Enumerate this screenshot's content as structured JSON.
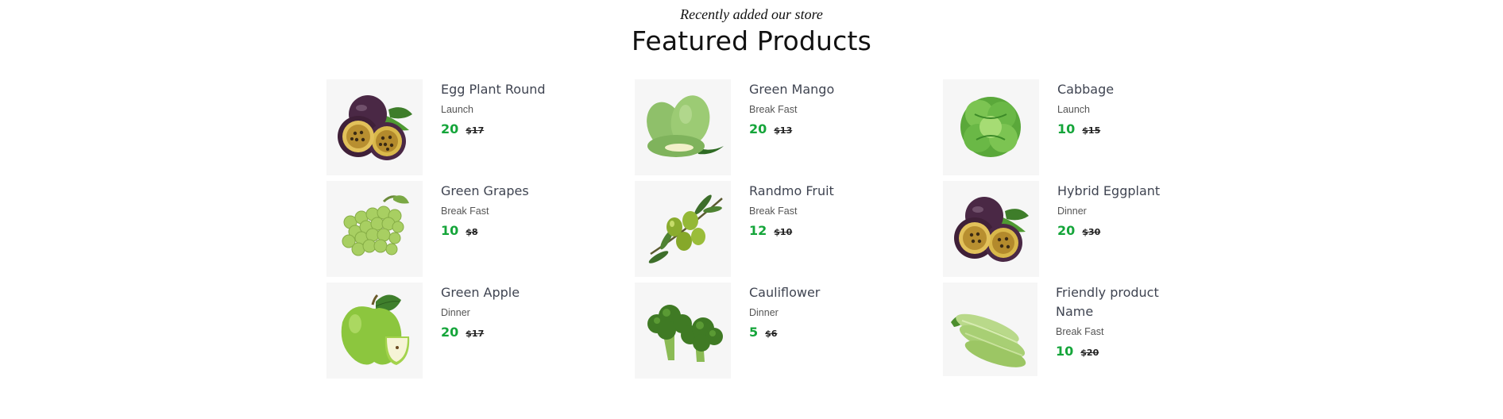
{
  "header": {
    "subtitle": "Recently added our store",
    "title": "Featured Products"
  },
  "colors": {
    "price": "#15a53a",
    "name": "#3f4451",
    "thumb_bg": "#f6f6f6"
  },
  "products": [
    {
      "name": "Egg Plant Round",
      "category": "Launch",
      "price": "20",
      "old_price": "17",
      "image": "passion-fruit-image"
    },
    {
      "name": "Green Mango",
      "category": "Break Fast",
      "price": "20",
      "old_price": "13",
      "image": "green-mango-image"
    },
    {
      "name": "Cabbage",
      "category": "Launch",
      "price": "10",
      "old_price": "15",
      "image": "lettuce-image"
    },
    {
      "name": "Green Grapes",
      "category": "Break Fast",
      "price": "10",
      "old_price": "8",
      "image": "green-grapes-image"
    },
    {
      "name": "Randmo Fruit",
      "category": "Break Fast",
      "price": "12",
      "old_price": "10",
      "image": "olive-branch-image"
    },
    {
      "name": "Hybrid Eggplant",
      "category": "Dinner",
      "price": "20",
      "old_price": "30",
      "image": "passion-fruit-image"
    },
    {
      "name": "Green Apple",
      "category": "Dinner",
      "price": "20",
      "old_price": "17",
      "image": "green-apple-image"
    },
    {
      "name": "Cauliflower",
      "category": "Dinner",
      "price": "5",
      "old_price": "6",
      "image": "broccoli-image"
    },
    {
      "name": "Friendly product Name",
      "category": "Break Fast",
      "price": "10",
      "old_price": "20",
      "image": "zucchini-image"
    }
  ]
}
